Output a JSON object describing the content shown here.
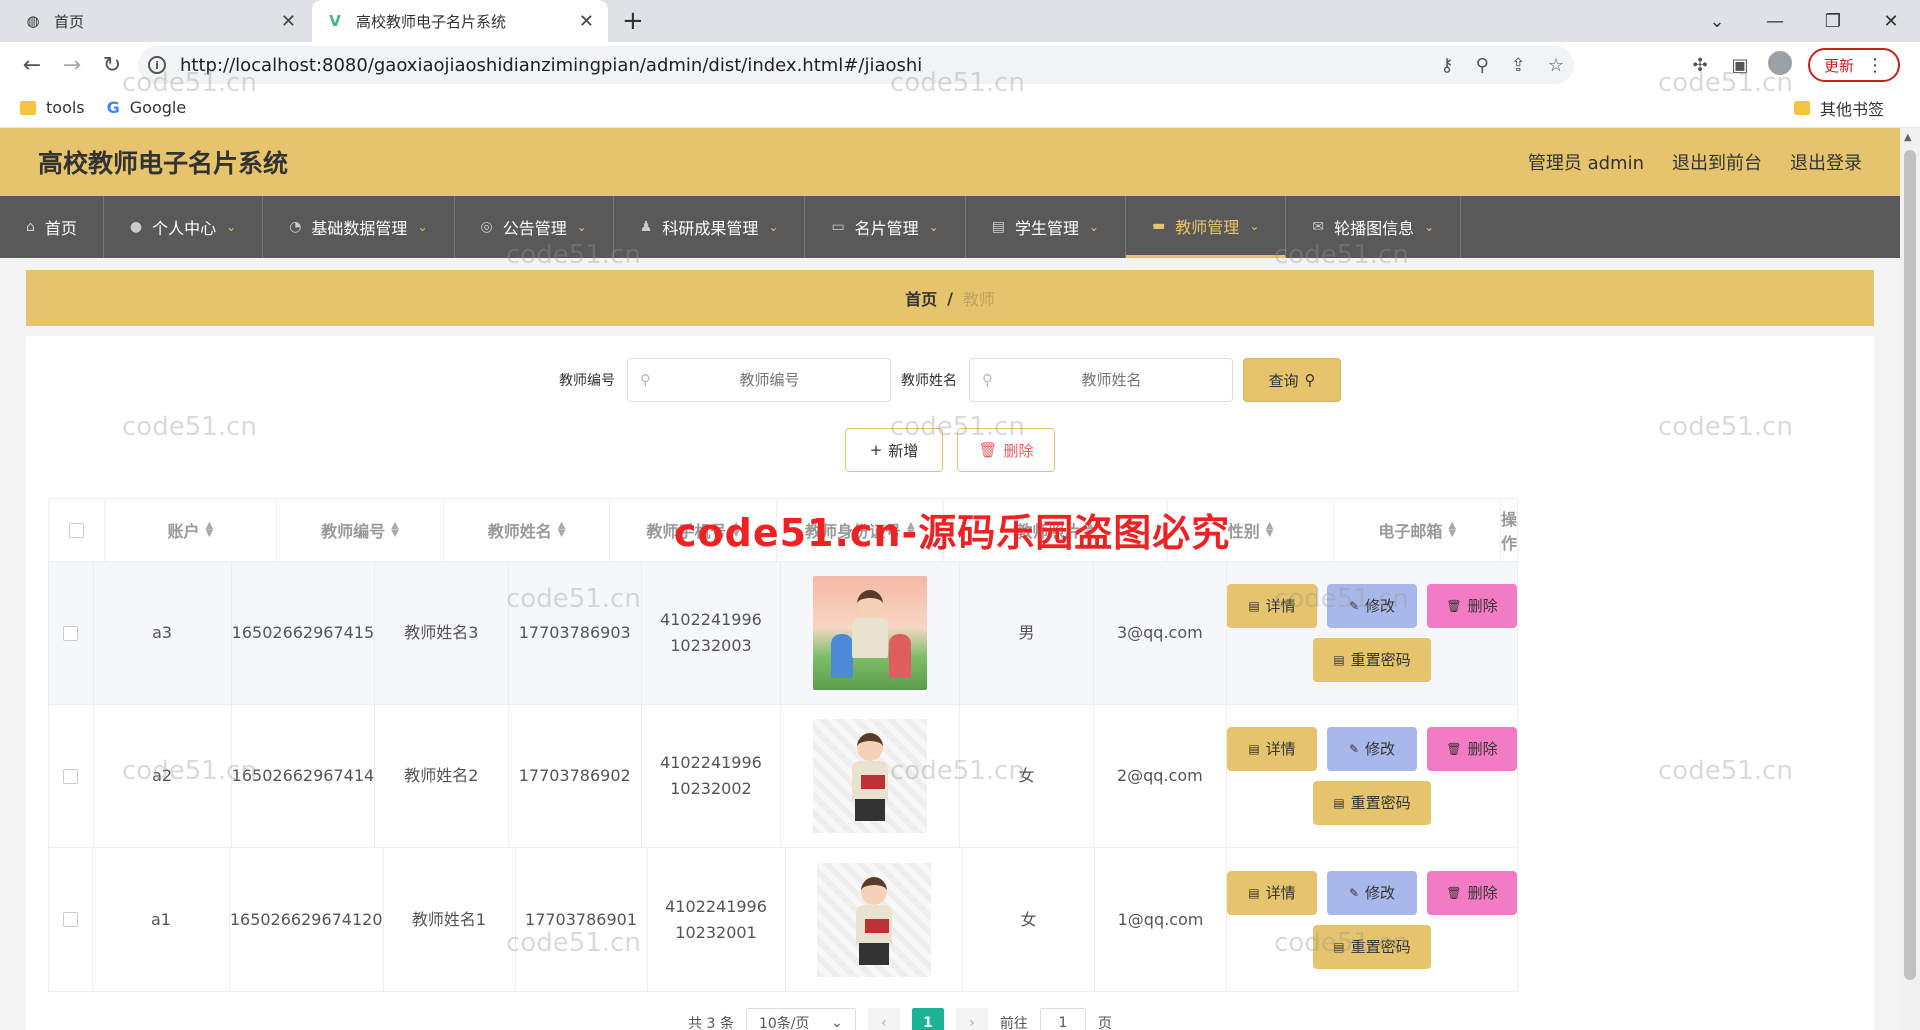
{
  "browser": {
    "tabs": [
      {
        "label": "首页",
        "active": false
      },
      {
        "label": "高校教师电子名片系统",
        "active": true
      }
    ],
    "url": "http://localhost:8080/gaoxiaojiaoshidianzimingpian/admin/dist/index.html#/jiaoshi",
    "update_label": "更新",
    "bookmarks": [
      "tools",
      "Google"
    ],
    "other_bookmarks": "其他书签"
  },
  "header": {
    "title": "高校教师电子名片系统",
    "user": "管理员 admin",
    "to_front": "退出到前台",
    "logout": "退出登录"
  },
  "menu": [
    {
      "label": "首页",
      "icon": "home-icon"
    },
    {
      "label": "个人中心",
      "icon": "user-icon"
    },
    {
      "label": "基础数据管理",
      "icon": "gauge-icon"
    },
    {
      "label": "公告管理",
      "icon": "globe-icon"
    },
    {
      "label": "科研成果管理",
      "icon": "person-icon"
    },
    {
      "label": "名片管理",
      "icon": "card-icon"
    },
    {
      "label": "学生管理",
      "icon": "briefcase-icon"
    },
    {
      "label": "教师管理",
      "icon": "monitor-icon"
    },
    {
      "label": "轮播图信息",
      "icon": "mail-icon"
    }
  ],
  "breadcrumb": {
    "home": "首页",
    "current": "教师"
  },
  "search": {
    "no_label": "教师编号",
    "no_placeholder": "教师编号",
    "name_label": "教师姓名",
    "name_placeholder": "教师姓名",
    "query_label": "查询"
  },
  "actions": {
    "add_label": "新增",
    "delete_label": "删除"
  },
  "table": {
    "columns": [
      "账户",
      "教师编号",
      "教师姓名",
      "教师手机号",
      "教师身份证号",
      "教师照片",
      "性别",
      "电子邮箱",
      "操作"
    ],
    "rows": [
      {
        "account": "a3",
        "no": "16502662967415",
        "name": "教师姓名3",
        "phone": "17703786903",
        "idcard": "410224199610232003",
        "gender": "男",
        "email": "3@qq.com"
      },
      {
        "account": "a2",
        "no": "16502662967414",
        "name": "教师姓名2",
        "phone": "17703786902",
        "idcard": "410224199610232002",
        "gender": "女",
        "email": "2@qq.com"
      },
      {
        "account": "a1",
        "no": "165026629674120",
        "name": "教师姓名1",
        "phone": "17703786901",
        "idcard": "410224199610232001",
        "gender": "女",
        "email": "1@qq.com"
      }
    ],
    "op_labels": {
      "detail": "详情",
      "edit": "修改",
      "delete": "删除",
      "reset": "重置密码"
    }
  },
  "pager": {
    "total": "共 3 条",
    "page_size": "10条/页",
    "current": "1",
    "goto_label": "前往",
    "goto_value": "1",
    "page_suffix": "页"
  },
  "watermark": {
    "small": "code51.cn",
    "big": "code51.cn-源码乐园盗图必究"
  }
}
